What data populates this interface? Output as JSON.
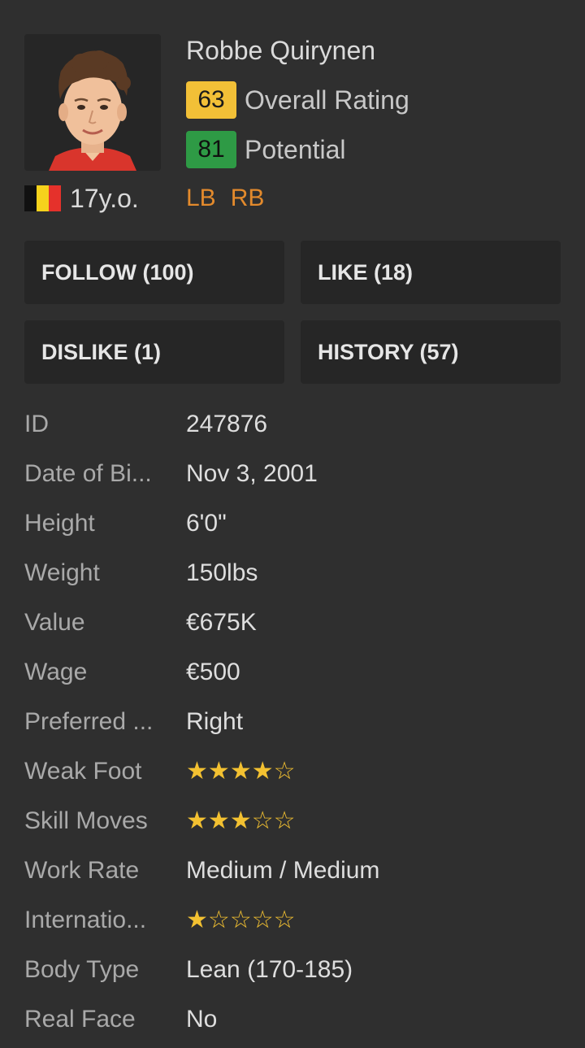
{
  "player": {
    "name": "Robbe Quirynen",
    "overall": "63",
    "overall_label": "Overall Rating",
    "potential": "81",
    "potential_label": "Potential",
    "age": "17y.o.",
    "nationality_flag": "belgium-flag",
    "positions": [
      "LB",
      "RB"
    ]
  },
  "actions": {
    "follow": "FOLLOW (100)",
    "like": "LIKE (18)",
    "dislike": "DISLIKE (1)",
    "history": "HISTORY (57)"
  },
  "info": {
    "id": {
      "label": "ID",
      "value": "247876"
    },
    "dob": {
      "label": "Date of Bi...",
      "value": "Nov 3, 2001"
    },
    "height": {
      "label": "Height",
      "value": "6'0\""
    },
    "weight": {
      "label": "Weight",
      "value": "150lbs"
    },
    "value": {
      "label": "Value",
      "value": "€675K"
    },
    "wage": {
      "label": "Wage",
      "value": "€500"
    },
    "preferred_foot": {
      "label": "Preferred ...",
      "value": "Right"
    },
    "weak_foot": {
      "label": "Weak Foot",
      "stars": 4,
      "max": 5
    },
    "skill_moves": {
      "label": "Skill Moves",
      "stars": 3,
      "max": 5
    },
    "work_rate": {
      "label": "Work Rate",
      "value": "Medium / Medium"
    },
    "international_rep": {
      "label": "Internatio...",
      "stars": 1,
      "max": 5
    },
    "body_type": {
      "label": "Body Type",
      "value": "Lean (170-185)"
    },
    "real_face": {
      "label": "Real Face",
      "value": "No"
    }
  },
  "colors": {
    "background": "#2f2f2f",
    "card": "#262626",
    "overall_badge": "#f2c037",
    "potential_badge": "#2e9a45",
    "position_text": "#e38a2c",
    "star": "#f3c131"
  }
}
